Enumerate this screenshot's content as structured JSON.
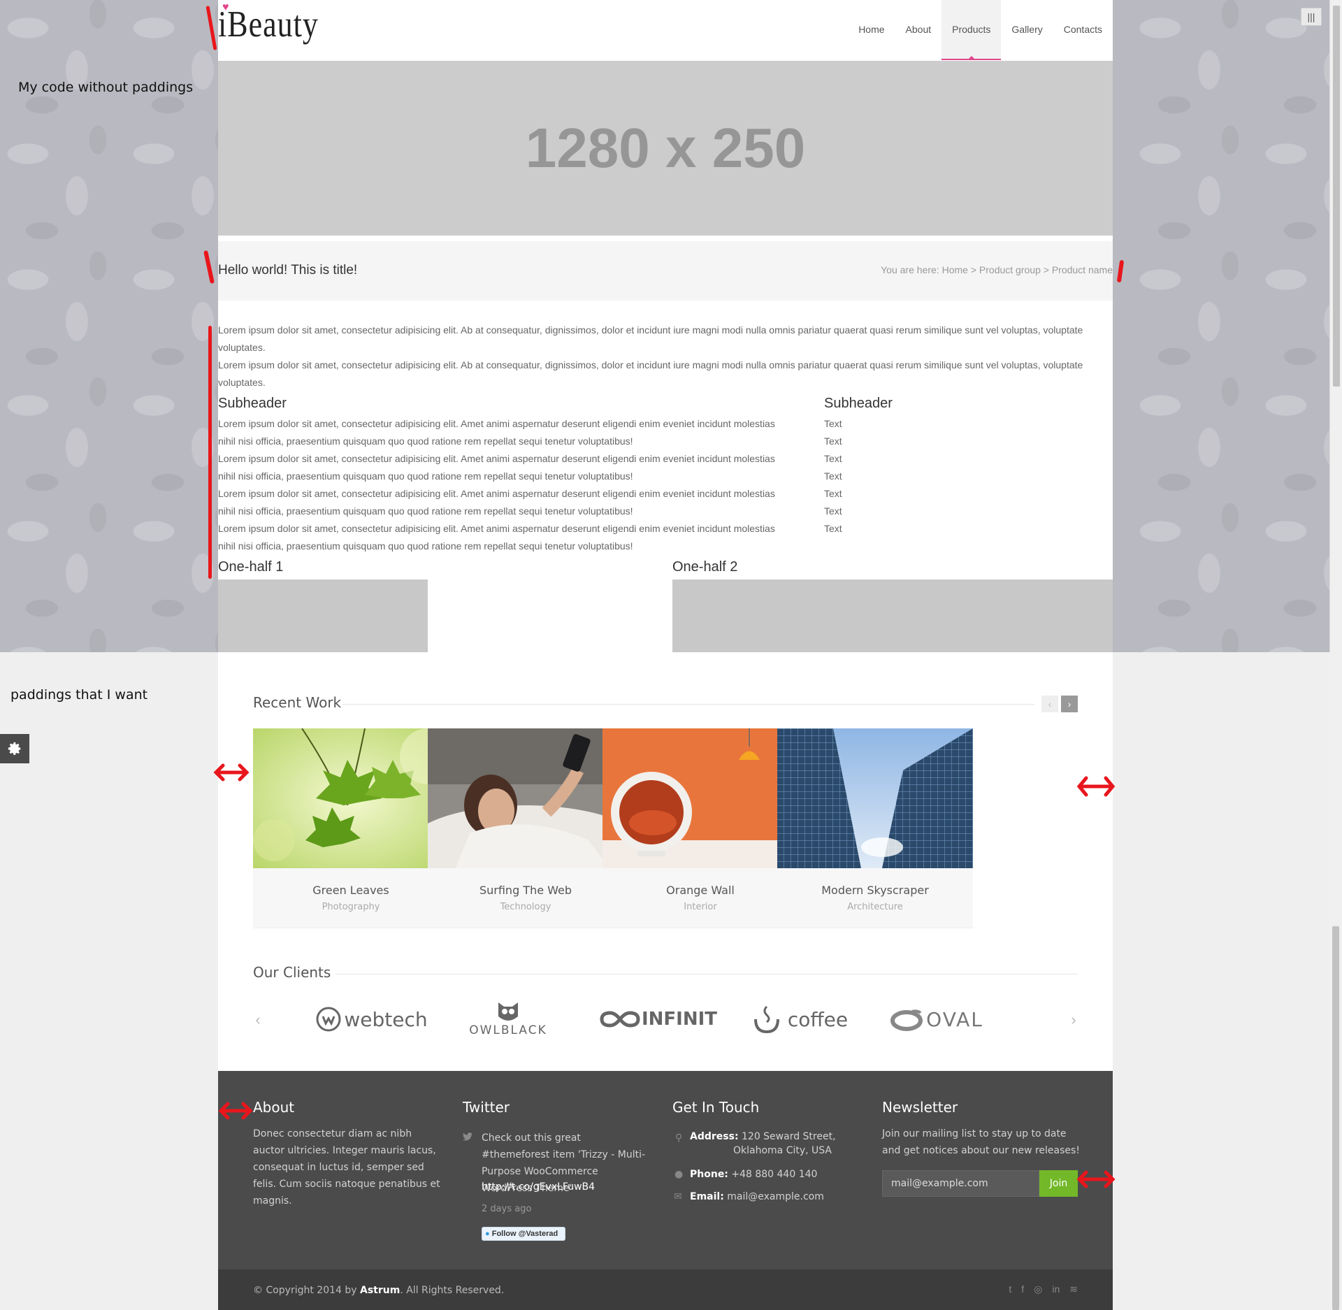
{
  "notes": {
    "top": "My code without paddings",
    "bottom": "paddings that I want"
  },
  "header": {
    "logo": "iBeauty",
    "nav": [
      "Home",
      "About",
      "Products",
      "Gallery",
      "Contacts"
    ],
    "active": "Products"
  },
  "hero": {
    "placeholder": "1280 x 250"
  },
  "titlebar": {
    "title": "Hello world! This is title!",
    "bc_prefix": "You are here:",
    "bc_home": "Home",
    "bc_sep1": ">",
    "bc_group": "Product group",
    "bc_sep2": ">",
    "bc_current": "Product name"
  },
  "content": {
    "intro": [
      "Lorem ipsum dolor sit amet, consectetur adipisicing elit. Ab at consequatur, dignissimos, dolor et incidunt iure magni modi nulla omnis pariatur quaerat quasi rerum similique sunt vel voluptas, voluptate voluptates.",
      "Lorem ipsum dolor sit amet, consectetur adipisicing elit. Ab at consequatur, dignissimos, dolor et incidunt iure magni modi nulla omnis pariatur quaerat quasi rerum similique sunt vel voluptas, voluptate voluptates."
    ],
    "subheader_left": "Subheader",
    "subheader_right": "Subheader",
    "left_lines": [
      "Lorem ipsum dolor sit amet, consectetur adipisicing elit. Amet animi aspernatur deserunt eligendi enim eveniet incidunt molestias",
      "nihil nisi officia, praesentium quisquam quo quod ratione rem repellat sequi tenetur voluptatibus!",
      "Lorem ipsum dolor sit amet, consectetur adipisicing elit. Amet animi aspernatur deserunt eligendi enim eveniet incidunt molestias",
      "nihil nisi officia, praesentium quisquam quo quod ratione rem repellat sequi tenetur voluptatibus!",
      "Lorem ipsum dolor sit amet, consectetur adipisicing elit. Amet animi aspernatur deserunt eligendi enim eveniet incidunt molestias",
      "nihil nisi officia, praesentium quisquam quo quod ratione rem repellat sequi tenetur voluptatibus!",
      "Lorem ipsum dolor sit amet, consectetur adipisicing elit. Amet animi aspernatur deserunt eligendi enim eveniet incidunt molestias",
      "nihil nisi officia, praesentium quisquam quo quod ratione rem repellat sequi tenetur voluptatibus!"
    ],
    "right_lines": [
      "Text",
      "Text",
      "Text",
      "Text",
      "Text",
      "Text",
      "Text"
    ],
    "half1": "One-half 1",
    "half2": "One-half 2"
  },
  "recent": {
    "title": "Recent Work",
    "items": [
      {
        "name": "Green Leaves",
        "cat": "Photography"
      },
      {
        "name": "Surfing The Web",
        "cat": "Technology"
      },
      {
        "name": "Orange Wall",
        "cat": "Interior"
      },
      {
        "name": "Modern Skyscraper",
        "cat": "Architecture"
      }
    ]
  },
  "clients": {
    "title": "Our Clients",
    "logos": [
      "webtech",
      "OWLBLACK",
      "INFINIT",
      "coffee",
      "OVAL"
    ]
  },
  "footer": {
    "about_title": "About",
    "about_text": "Donec consectetur diam ac nibh auctor ultricies. Integer mauris lacus, consequat in luctus id, semper sed felis. Cum sociis natoque penatibus et magnis.",
    "twitter_title": "Twitter",
    "tweet": "Check out this great #themeforest item 'Trizzy - Multi-Purpose WooCommerce WordPress Theme'",
    "tweet_link": "http://t.co/gEvxLFuwB4",
    "tweet_time": "2 days ago",
    "follow": "Follow @Vasterad",
    "contact_title": "Get In Touch",
    "addr_label": "Address:",
    "addr1": "120 Seward Street,",
    "addr2": "Oklahoma City, USA",
    "phone_label": "Phone:",
    "phone": "+48 880 440 140",
    "email_label": "Email:",
    "email": "mail@example.com",
    "news_title": "Newsletter",
    "news_text": "Join our mailing list to stay up to date and get notices about our new releases!",
    "mail_placeholder": "mail@example.com",
    "join": "Join",
    "copy_pre": "© Copyright 2014 by",
    "copy_brand": "Astrum",
    "copy_post": ". All Rights Reserved."
  },
  "colors": {
    "accent": "#e0468a",
    "green": "#73b829",
    "footer_bg": "#4b4b4b",
    "annotation": "#e8161c"
  }
}
